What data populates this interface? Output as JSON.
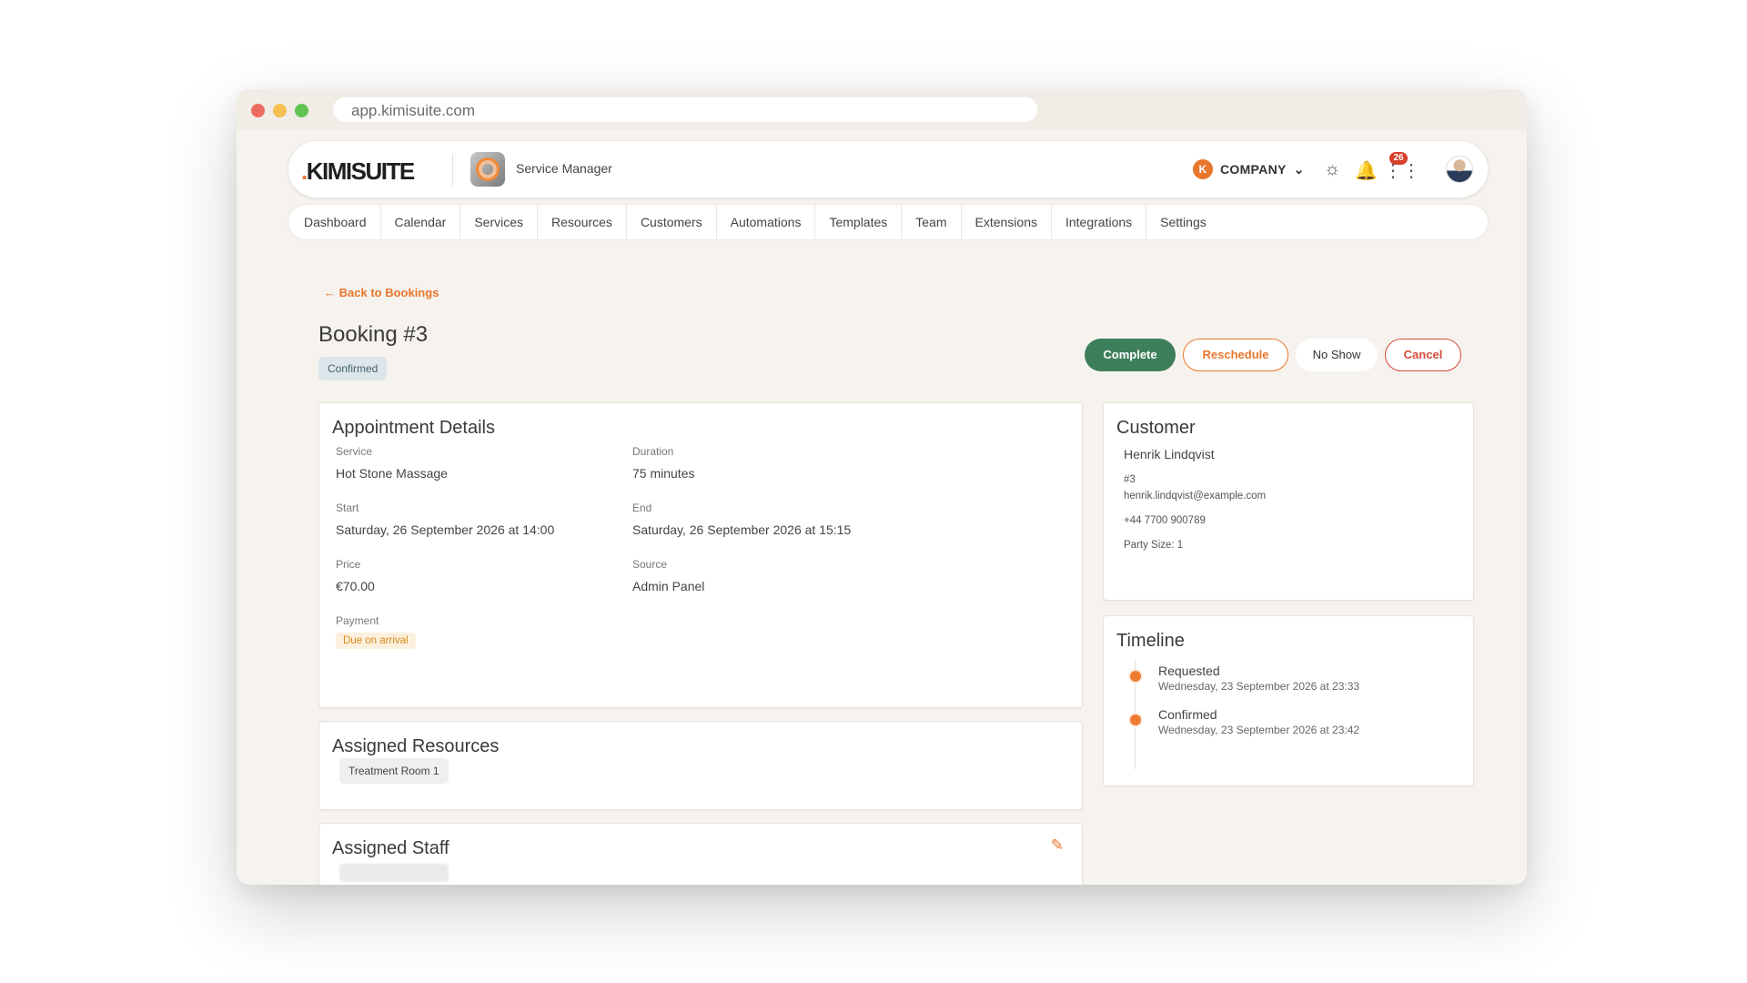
{
  "browser": {
    "url": "app.kimisuite.com"
  },
  "header": {
    "logo": "KIMISUITE",
    "app_name": "Service Manager",
    "company_initial": "K",
    "company": "COMPANY",
    "notification_count": "26"
  },
  "nav": [
    "Dashboard",
    "Calendar",
    "Services",
    "Resources",
    "Customers",
    "Automations",
    "Templates",
    "Team",
    "Extensions",
    "Integrations",
    "Settings"
  ],
  "page": {
    "back": "Back to Bookings",
    "title": "Booking #3",
    "status": "Confirmed"
  },
  "actions": {
    "complete": "Complete",
    "reschedule": "Reschedule",
    "no_show": "No Show",
    "cancel": "Cancel"
  },
  "appointment": {
    "heading": "Appointment Details",
    "service_label": "Service",
    "service": "Hot Stone Massage",
    "duration_label": "Duration",
    "duration": "75 minutes",
    "start_label": "Start",
    "start": "Saturday, 26 September 2026 at 14:00",
    "end_label": "End",
    "end": "Saturday, 26 September 2026 at 15:15",
    "price_label": "Price",
    "price": "€70.00",
    "source_label": "Source",
    "source": "Admin Panel",
    "payment_label": "Payment",
    "payment": "Due on arrival"
  },
  "resources": {
    "heading": "Assigned Resources",
    "items": [
      "Treatment Room 1"
    ]
  },
  "staff": {
    "heading": "Assigned Staff"
  },
  "customer": {
    "heading": "Customer",
    "name": "Henrik Lindqvist",
    "id": "#3",
    "email": "henrik.lindqvist@example.com",
    "phone": "+44 7700 900789",
    "party": "Party Size: 1"
  },
  "timeline": {
    "heading": "Timeline",
    "events": [
      {
        "title": "Requested",
        "date": "Wednesday, 23 September 2026 at 23:33"
      },
      {
        "title": "Confirmed",
        "date": "Wednesday, 23 September 2026 at 23:42"
      }
    ]
  },
  "colors": {
    "accent": "#e8762c",
    "success": "#3e7f5b",
    "danger": "#d54a3a"
  }
}
